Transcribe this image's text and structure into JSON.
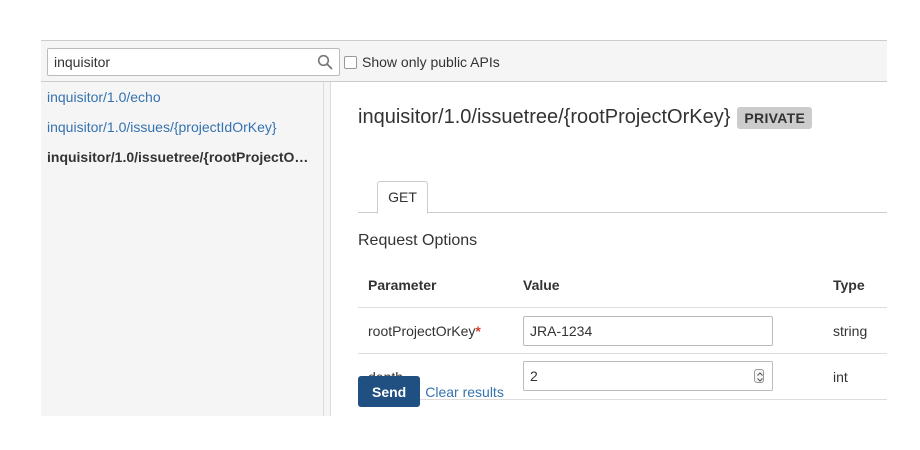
{
  "toolbar": {
    "search_value": "inquisitor",
    "public_only_label": "Show only public APIs",
    "public_only_checked": false
  },
  "sidebar": {
    "items": [
      {
        "label": "inquisitor/1.0/echo",
        "active": false
      },
      {
        "label": "inquisitor/1.0/issues/{projectIdOrKey}",
        "active": false
      },
      {
        "label": "inquisitor/1.0/issuetree/{rootProjectO…",
        "active": true
      }
    ]
  },
  "main": {
    "title": "inquisitor/1.0/issuetree/{rootProjectOrKey}",
    "badge": "PRIVATE",
    "tabs": [
      {
        "label": "GET"
      }
    ],
    "section_title": "Request Options",
    "params": {
      "headers": {
        "parameter": "Parameter",
        "value": "Value",
        "type": "Type"
      },
      "rows": [
        {
          "name": "rootProjectOrKey",
          "required_mark": "*",
          "value": "JRA-1234",
          "type": "string"
        },
        {
          "name": "depth",
          "required_mark": "",
          "value": "2",
          "type": "int"
        }
      ]
    },
    "send_label": "Send",
    "clear_label": "Clear results"
  },
  "colors": {
    "link": "#3572b0",
    "primary_button": "#205081",
    "badge_bg": "#cccccc",
    "required": "#d04437",
    "panel_bg": "#f5f5f5"
  },
  "icons": {
    "search": "search-icon",
    "spinner": "spinner-icon"
  }
}
